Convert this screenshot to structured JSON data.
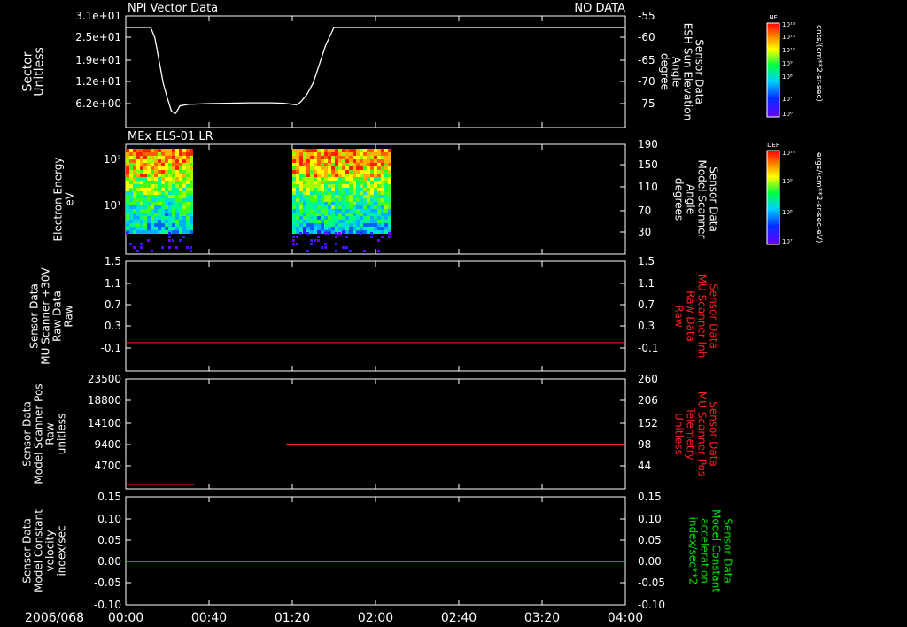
{
  "time_axis": {
    "date_label": "2006/068",
    "ticks": [
      "00:00",
      "00:40",
      "01:20",
      "02:00",
      "02:40",
      "03:20",
      "04:00"
    ],
    "tick_minutes": [
      0,
      40,
      80,
      120,
      160,
      200,
      240
    ],
    "range_minutes": [
      0,
      240
    ]
  },
  "colors": {
    "line_white": "#ffffff",
    "line_red": "#ff2020",
    "line_green": "#00e000",
    "label_red": "#ff2020",
    "label_green": "#00e000"
  },
  "panels": [
    {
      "id": "p1",
      "title_left": "NPI Vector Data",
      "title_right": "NO DATA",
      "left_label": [
        "Sector",
        "Unitless"
      ],
      "left_ticks": [
        "3.1e+01",
        "2.5e+01",
        "1.9e+01",
        "1.2e+01",
        "6.2e+00"
      ],
      "right_label": [
        "Sensor Data",
        "ESH Sun Elevation",
        "Angle",
        "degree"
      ],
      "right_ticks": [
        "-55",
        "-60",
        "-65",
        "-70",
        "-75"
      ]
    },
    {
      "id": "p2",
      "title_left": "MEx ELS-01 LR",
      "left_label": [
        "Electron Energy",
        "eV"
      ],
      "left_ticks": [
        "10²",
        "10¹"
      ],
      "right_label": [
        "Sensor Data",
        "Model Scanner",
        "Angle",
        "degrees"
      ],
      "right_ticks": [
        "190",
        "150",
        "110",
        "70",
        "30"
      ]
    },
    {
      "id": "p3",
      "left_label": [
        "Sensor Data",
        "MU Scanner +30V",
        "Raw Data",
        "Raw"
      ],
      "left_ticks": [
        "1.5",
        "1.1",
        "0.7",
        "0.3",
        "-0.1"
      ],
      "right_label": [
        "Sensor Data",
        "MU Scanner Inh",
        "Raw Data",
        "Raw"
      ],
      "right_ticks": [
        "1.5",
        "1.1",
        "0.7",
        "0.3",
        "-0.1"
      ]
    },
    {
      "id": "p4",
      "left_label": [
        "Sensor Data",
        "Model Scanner Pos",
        "Raw",
        "unitless"
      ],
      "left_ticks": [
        "23500",
        "18800",
        "14100",
        "9400",
        "4700"
      ],
      "right_label": [
        "Sensor Data",
        "MU Scanner Pos",
        "Telemetry",
        "Unitless"
      ],
      "right_ticks": [
        "260",
        "206",
        "152",
        "98",
        "44"
      ]
    },
    {
      "id": "p5",
      "left_label": [
        "Sensor Data",
        "Model Constant",
        "velocity",
        "index/sec"
      ],
      "left_ticks": [
        "0.15",
        "0.10",
        "0.05",
        "0.00",
        "-0.05",
        "-0.10"
      ],
      "right_label": [
        "Sensor Data",
        "Model Constant",
        "acceleration",
        "index/sec**2"
      ],
      "right_ticks": [
        "0.15",
        "0.10",
        "0.05",
        "0.00",
        "-0.05",
        "-0.10"
      ]
    }
  ],
  "colorbars": [
    {
      "id": "cb1",
      "title": "NF",
      "top_label": "10¹²",
      "mid_labels": [
        "10¹¹",
        "10¹⁰",
        "10⁹",
        "10⁸",
        "10⁷"
      ],
      "bottom_label": "10⁶",
      "units": "cnts/(cm**2-sr-sec)"
    },
    {
      "id": "cb2",
      "title": "DEF",
      "top_label": "10¹⁰",
      "mid_labels": [
        "10⁹",
        "10⁸"
      ],
      "bottom_label": "10⁷",
      "units": "ergs/(cm**2-sr-sec-eV)"
    }
  ],
  "chart_data": [
    {
      "type": "line",
      "panel": "p1",
      "title": "NPI Vector Data",
      "ylabel": "Sensor Data ESH Sun Elevation Angle degree",
      "ylim": [
        -78,
        -54
      ],
      "series": [
        {
          "x_minutes": [
            0,
            12,
            14,
            16,
            18,
            20,
            22,
            24,
            26,
            30,
            40,
            60,
            70,
            76,
            80,
            82,
            84,
            87,
            90,
            93,
            96,
            100,
            240
          ],
          "y": [
            -55.2,
            -55.2,
            -58,
            -64,
            -70,
            -74,
            -77.5,
            -78,
            -76,
            -75.6,
            -75.4,
            -75.2,
            -75.2,
            -75.3,
            -75.6,
            -75.7,
            -75,
            -73,
            -70,
            -65,
            -60,
            -55.2,
            -55.2
          ]
        }
      ]
    },
    {
      "type": "heatmap",
      "panel": "p2",
      "title": "MEx ELS-01 LR",
      "ylabel": "Electron Energy eV",
      "ylim_eV": [
        1,
        190
      ],
      "yscale": "log",
      "colorbar_units": "ergs/(cm**2-sr-sec-eV)",
      "data_intervals_minutes": [
        [
          0,
          32
        ],
        [
          80,
          127
        ]
      ]
    },
    {
      "type": "line",
      "panel": "p3",
      "ylabel": "Sensor Data MU Scanner +30V Raw Data Raw",
      "ylim": [
        -0.5,
        1.5
      ],
      "series": [
        {
          "x_minutes": [
            0,
            240
          ],
          "y": [
            0.0,
            0.0
          ]
        }
      ]
    },
    {
      "type": "line",
      "panel": "p4",
      "ylabel": "Sensor Data Model Scanner Pos Raw unitless",
      "series": [
        {
          "x_minutes": [
            0,
            33
          ],
          "y_left": 0
        },
        {
          "x_minutes": [
            77,
            240
          ],
          "y_right": 98
        }
      ],
      "ylim_left": [
        0,
        23500
      ],
      "ylim_right": [
        0,
        260
      ]
    },
    {
      "type": "line",
      "panel": "p5",
      "ylabel": "Sensor Data Model Constant velocity index/sec",
      "ylim": [
        -0.1,
        0.15
      ],
      "series": [
        {
          "x_minutes": [
            0,
            240
          ],
          "y": [
            0.0,
            0.0
          ]
        }
      ]
    }
  ]
}
